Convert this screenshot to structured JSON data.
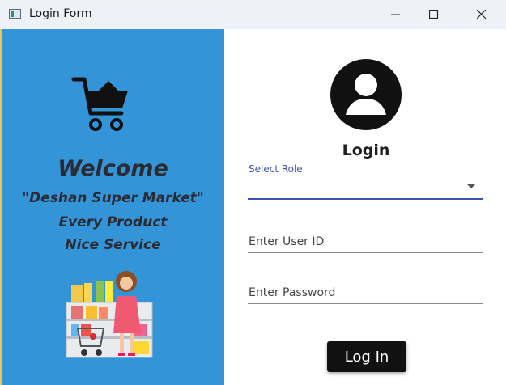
{
  "window": {
    "title": "Login Form",
    "controls": [
      "minimize-icon",
      "maximize-icon",
      "close-icon"
    ]
  },
  "left_panel": {
    "background": "#3494d8",
    "icon": "shopping-cart-icon",
    "welcome": "Welcome",
    "store_name": "\"Deshan Super Market\"",
    "tagline_1": "Every Product",
    "tagline_2": "Nice Service",
    "illustration": "shopper-illustration"
  },
  "form": {
    "avatar_icon": "user-avatar-icon",
    "title": "Login",
    "role": {
      "label": "Select Role",
      "value": ""
    },
    "user_id": {
      "placeholder": "Enter User ID",
      "value": ""
    },
    "password": {
      "placeholder": "Enter Password",
      "value": ""
    },
    "login_button": "Log In",
    "accent": "#3f51b5"
  }
}
